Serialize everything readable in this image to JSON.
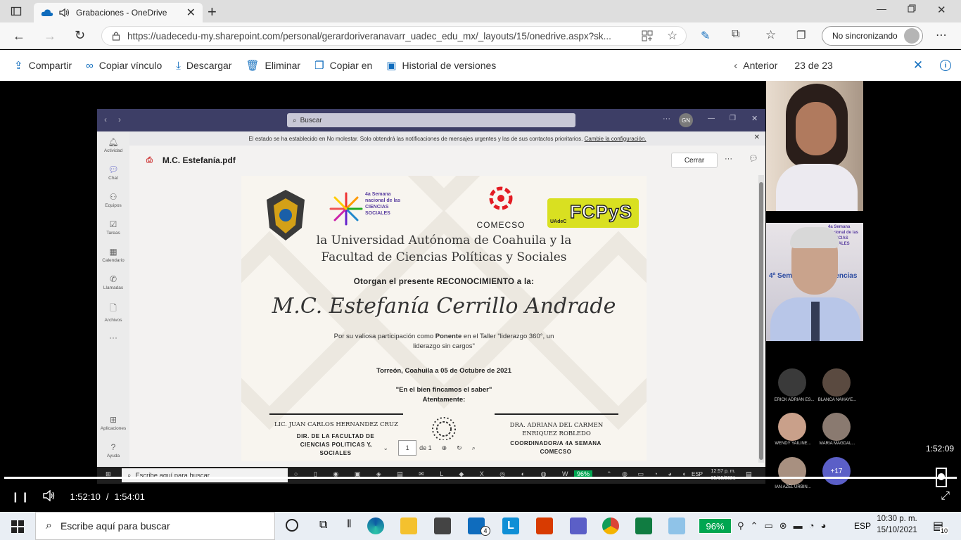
{
  "browser": {
    "tab_title": "Grabaciones - OneDrive",
    "url": "https://uadecedu-my.sharepoint.com/personal/gerardoriveranavarr_uadec_edu_mx/_layouts/15/onedrive.aspx?sk...",
    "sync_label": "No sincronizando"
  },
  "commands": {
    "share": "Compartir",
    "copy_link": "Copiar vínculo",
    "download": "Descargar",
    "delete": "Eliminar",
    "copy_to": "Copiar en",
    "version_history": "Historial de versiones",
    "previous": "Anterior",
    "position": "23 de 23"
  },
  "teams": {
    "search_placeholder": "Buscar",
    "avatar_initials": "GN",
    "dnd_message": "El estado se ha establecido en No molestar. Solo obtendrá las notificaciones de mensajes urgentes y las de sus contactos prioritarios.",
    "dnd_link": "Cambie la configuración.",
    "file_name": "M.C. Estefanía.pdf",
    "close_label": "Cerrar",
    "rail": [
      "Actividad",
      "Chat",
      "Equipos",
      "Tareas",
      "Calendario",
      "Llamadas",
      "Archivos"
    ],
    "apps_label": "Aplicaciones",
    "help_label": "Ayuda",
    "page_current": "1",
    "page_of": "de 1",
    "inner_search": "Escribe aquí para buscar",
    "inner_battery": "96%",
    "inner_lang": "ESP",
    "inner_time": "12:57 p. m.",
    "inner_date": "05/10/2021"
  },
  "certificate": {
    "logo_semana": "4a Semana nacional de las CIENCIAS SOCIALES",
    "logo_comecso": "COMECSO",
    "logo_fcpys": "FCPyS",
    "logo_uadec": "UAdeC",
    "title_line1": "la Universidad Autónoma de Coahuila y la",
    "title_line2": "Facultad de Ciencias Políticas y Sociales",
    "award_line": "Otorgan el presente RECONOCIMIENTO a la:",
    "recipient": "M.C. Estefanía Cerrillo Andrade",
    "desc_prefix": "Por su valiosa participación como ",
    "desc_role": "Ponente",
    "desc_suffix": " en el Taller \"liderazgo 360°, un liderazgo sin cargos\"",
    "date_line": "Torreón, Coahuila a 05 de Octubre de 2021",
    "motto": "\"En el bien fincamos el saber\"",
    "closing": "Atentamente:",
    "sig1_name": "LIC. JUAN CARLOS HERNANDEZ CRUZ",
    "sig1_role": "DIR. DE LA FACULTAD DE CIENCIAS POLITICAS Y SOCIALES",
    "sig2_name": "DRA. ADRIANA DEL CARMEN ENRIQUEZ ROBLEDO",
    "sig2_role": "COORDINADOR/A 4A SEMANA COMECSO"
  },
  "participants": [
    {
      "name": "ERICK ADRIAN ES...",
      "color": "#3a3a3a"
    },
    {
      "name": "BLANCA NAHAYE...",
      "color": "#5a4a40"
    },
    {
      "name": "WENDY YAILINE...",
      "color": "#c9a08a"
    },
    {
      "name": "MARIA MAGDAL...",
      "color": "#8a7a70"
    },
    {
      "name": "IAN AZEL URBIN...",
      "color": "#a89080"
    }
  ],
  "overflow_count": "+17",
  "cam2_banner": "4a Semana nacional de las CIENCIAS SOCIALES",
  "cam2_caption": "4ª Semana de las Ciencias",
  "video": {
    "hover_time": "1:52:09",
    "current": "1:52:10",
    "separator": "/",
    "total": "1:54:01",
    "progress_fraction": 0.981
  },
  "taskbar": {
    "search_placeholder": "Escribe aquí para buscar",
    "mail_badge": "4",
    "battery": "96%",
    "lang": "ESP",
    "time": "10:30 p. m.",
    "date": "15/10/2021",
    "notif_count": "10"
  },
  "colors": {
    "accent": "#0f6cbd",
    "teams_title": "#3d3e66",
    "battery": "#00a651"
  }
}
